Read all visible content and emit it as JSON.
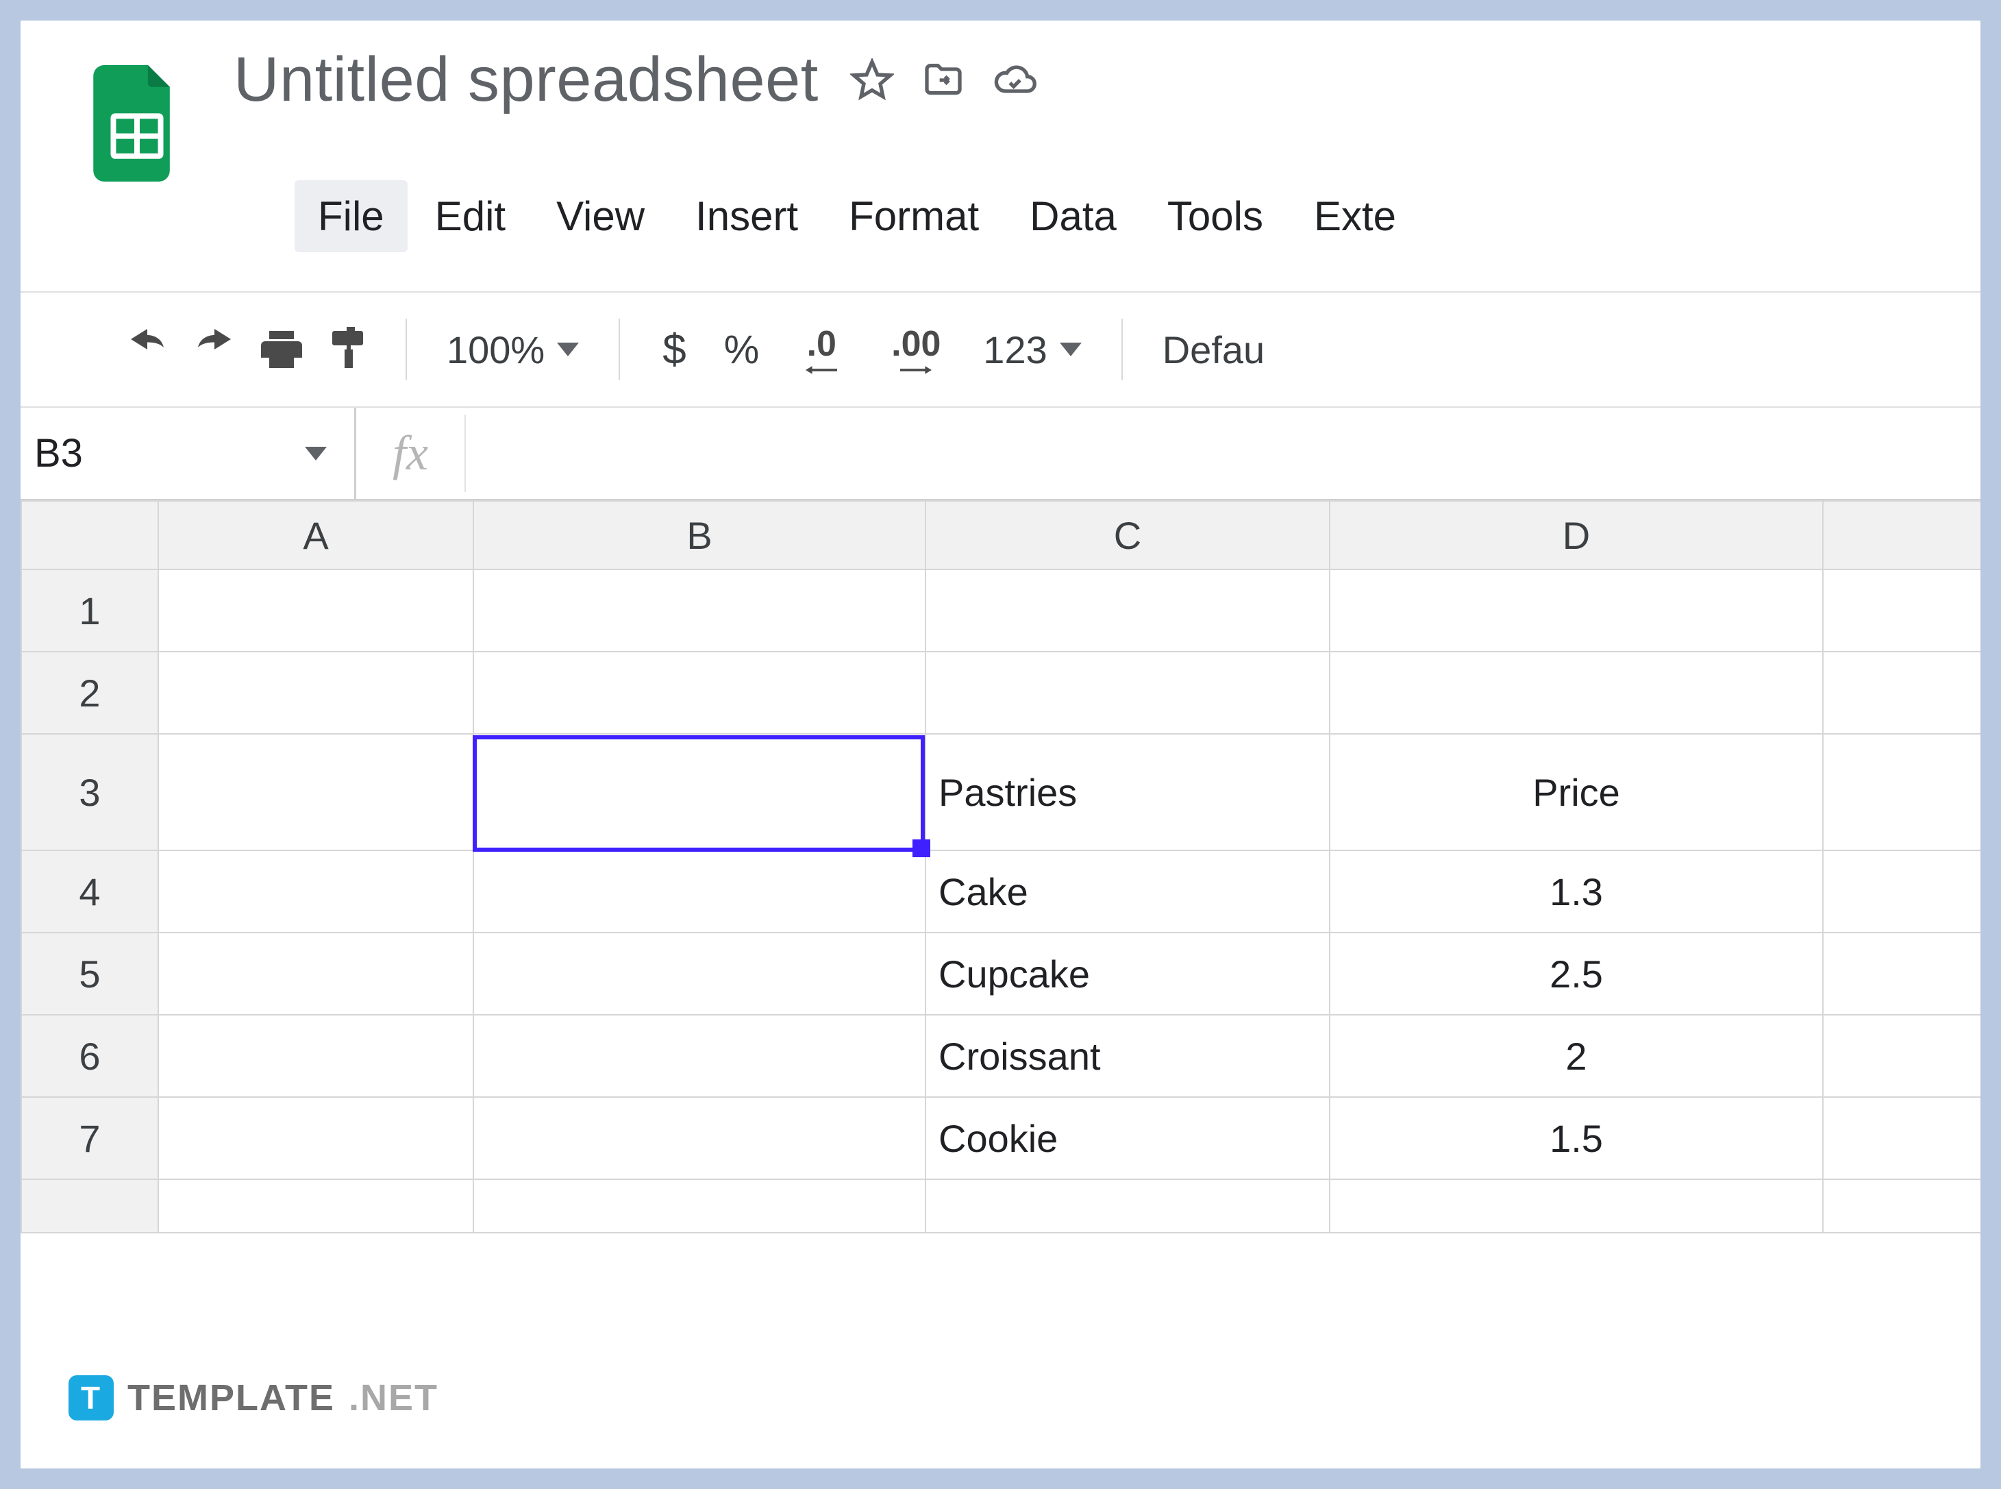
{
  "header": {
    "title": "Untitled spreadsheet"
  },
  "menubar": {
    "items": [
      "File",
      "Edit",
      "View",
      "Insert",
      "Format",
      "Data",
      "Tools",
      "Exte"
    ],
    "active_index": 0
  },
  "toolbar": {
    "zoom": "100%",
    "currency": "$",
    "percent": "%",
    "dec_decrease": ".0",
    "dec_increase": ".00",
    "format_more": "123",
    "font_partial": "Defau"
  },
  "fxbar": {
    "name_box": "B3",
    "fx_symbol": "fx",
    "formula": ""
  },
  "grid": {
    "columns": [
      "A",
      "B",
      "C",
      "D"
    ],
    "rows": [
      "1",
      "2",
      "3",
      "4",
      "5",
      "6",
      "7"
    ],
    "selected_cell": "B3",
    "cells": {
      "C3": "Pastries",
      "D3": "Price",
      "C4": "Cake",
      "D4": "1.3",
      "C5": "Cupcake",
      "D5": "2.5",
      "C6": "Croissant",
      "D6": "2",
      "C7": "Cookie",
      "D7": "1.5"
    }
  },
  "watermark": {
    "brand": "TEMPLATE",
    "suffix": ".NET",
    "badge": "T"
  }
}
